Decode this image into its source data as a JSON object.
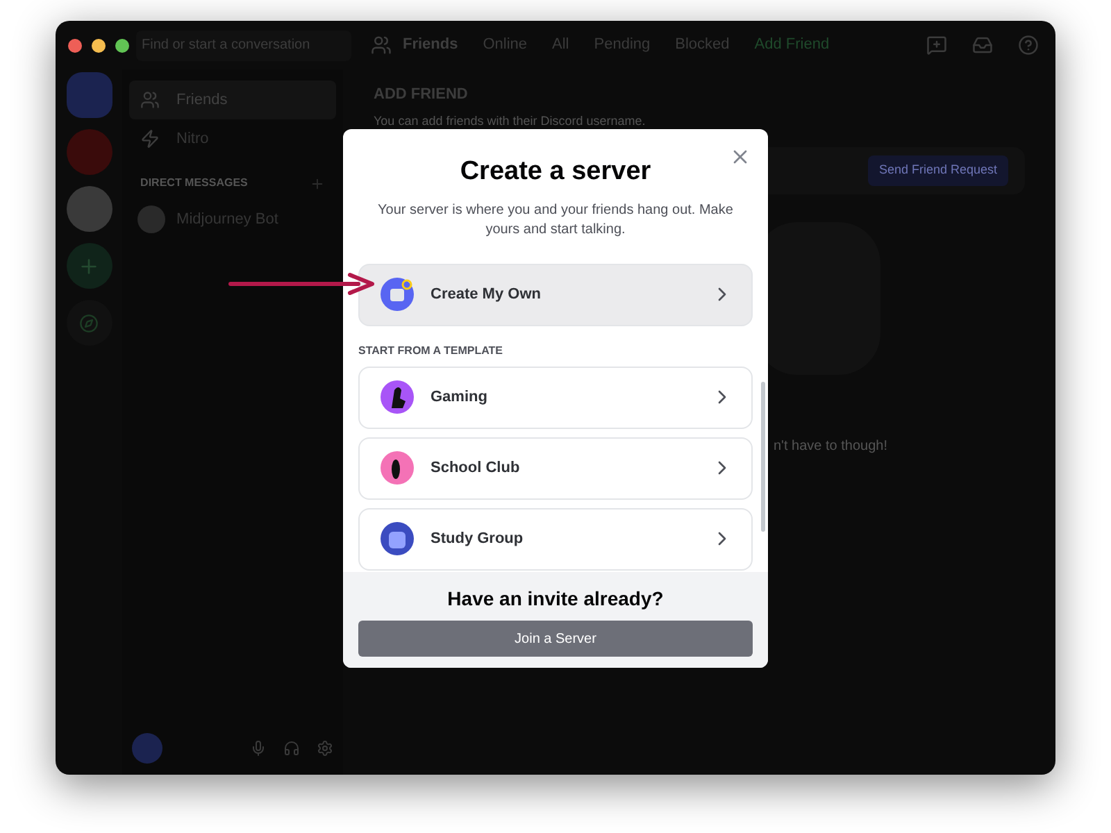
{
  "search": {
    "placeholder": "Find or start a conversation"
  },
  "header": {
    "title": "Friends",
    "tabs": [
      {
        "label": "Online",
        "selected": false
      },
      {
        "label": "All",
        "selected": false
      },
      {
        "label": "Pending",
        "selected": false
      },
      {
        "label": "Blocked",
        "selected": false
      },
      {
        "label": "Add Friend",
        "selected": true
      }
    ]
  },
  "sidebar": {
    "items": [
      {
        "label": "Friends",
        "kind": "friends",
        "selected": true
      },
      {
        "label": "Nitro",
        "kind": "nitro",
        "selected": false
      }
    ],
    "section": "DIRECT MESSAGES",
    "dms": [
      {
        "name": "Midjourney Bot"
      }
    ]
  },
  "main": {
    "heading": "ADD FRIEND",
    "description": "You can add friends with their Discord username.",
    "button": "Send Friend Request",
    "empty_text": "n't have to though!"
  },
  "modal": {
    "title": "Create a server",
    "subtitle": "Your server is where you and your friends hang out. Make yours and start talking.",
    "primary": {
      "label": "Create My Own",
      "kind": "own"
    },
    "section": "START FROM A TEMPLATE",
    "templates": [
      {
        "label": "Gaming",
        "kind": "gaming"
      },
      {
        "label": "School Club",
        "kind": "school"
      },
      {
        "label": "Study Group",
        "kind": "study"
      }
    ],
    "footer_title": "Have an invite already?",
    "footer_button": "Join a Server"
  }
}
